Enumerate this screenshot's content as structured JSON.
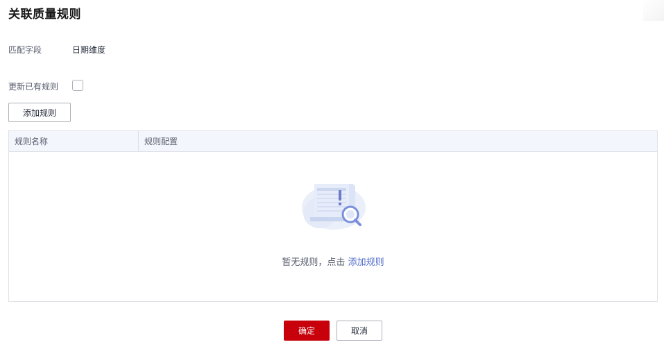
{
  "dialog": {
    "title": "关联质量规则"
  },
  "form": {
    "match_field_label": "匹配字段",
    "match_field_value": "日期维度",
    "update_existing_label": "更新已有规则",
    "update_existing_checked": false
  },
  "toolbar": {
    "add_rule_label": "添加规则"
  },
  "table": {
    "columns": [
      "规则名称",
      "规则配置"
    ],
    "rows": [],
    "empty_text": "暂无规则，点击",
    "empty_link": "添加规则",
    "empty_icon": "document-search-icon"
  },
  "footer": {
    "confirm_label": "确定",
    "cancel_label": "取消"
  },
  "colors": {
    "primary": "#c7000b",
    "link": "#526ecc",
    "header_bg": "#f3f6fc"
  }
}
